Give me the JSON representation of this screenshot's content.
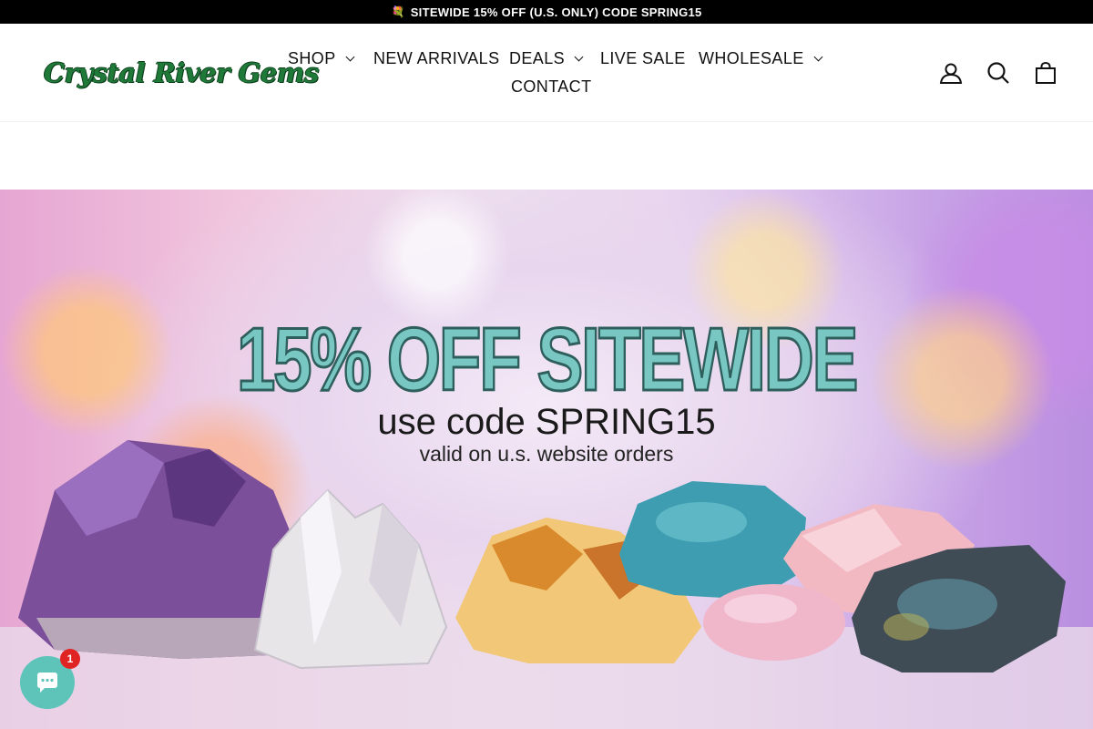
{
  "announcement": {
    "icon": "flower-icon",
    "text": "SITEWIDE 15% OFF (U.S. ONLY) CODE SPRING15"
  },
  "header": {
    "logo_text": "Crystal River Gems",
    "nav": [
      {
        "label": "SHOP",
        "has_dropdown": true
      },
      {
        "label": "NEW ARRIVALS",
        "has_dropdown": false
      },
      {
        "label": "DEALS",
        "has_dropdown": true
      },
      {
        "label": "LIVE SALE",
        "has_dropdown": false
      },
      {
        "label": "WHOLESALE",
        "has_dropdown": true
      },
      {
        "label": "CONTACT",
        "has_dropdown": false
      }
    ],
    "icons": [
      "account-icon",
      "search-icon",
      "cart-icon"
    ]
  },
  "hero": {
    "title": "15% OFF SITEWIDE",
    "subtitle": "use code SPRING15",
    "note": "valid on u.s. website orders"
  },
  "chat": {
    "icon": "chat-icon",
    "badge": "1"
  },
  "colors": {
    "logo_green": "#1f7a3a",
    "hero_title": "#78c7c3",
    "chat_button": "#5ec4b9",
    "badge_red": "#e02424"
  }
}
